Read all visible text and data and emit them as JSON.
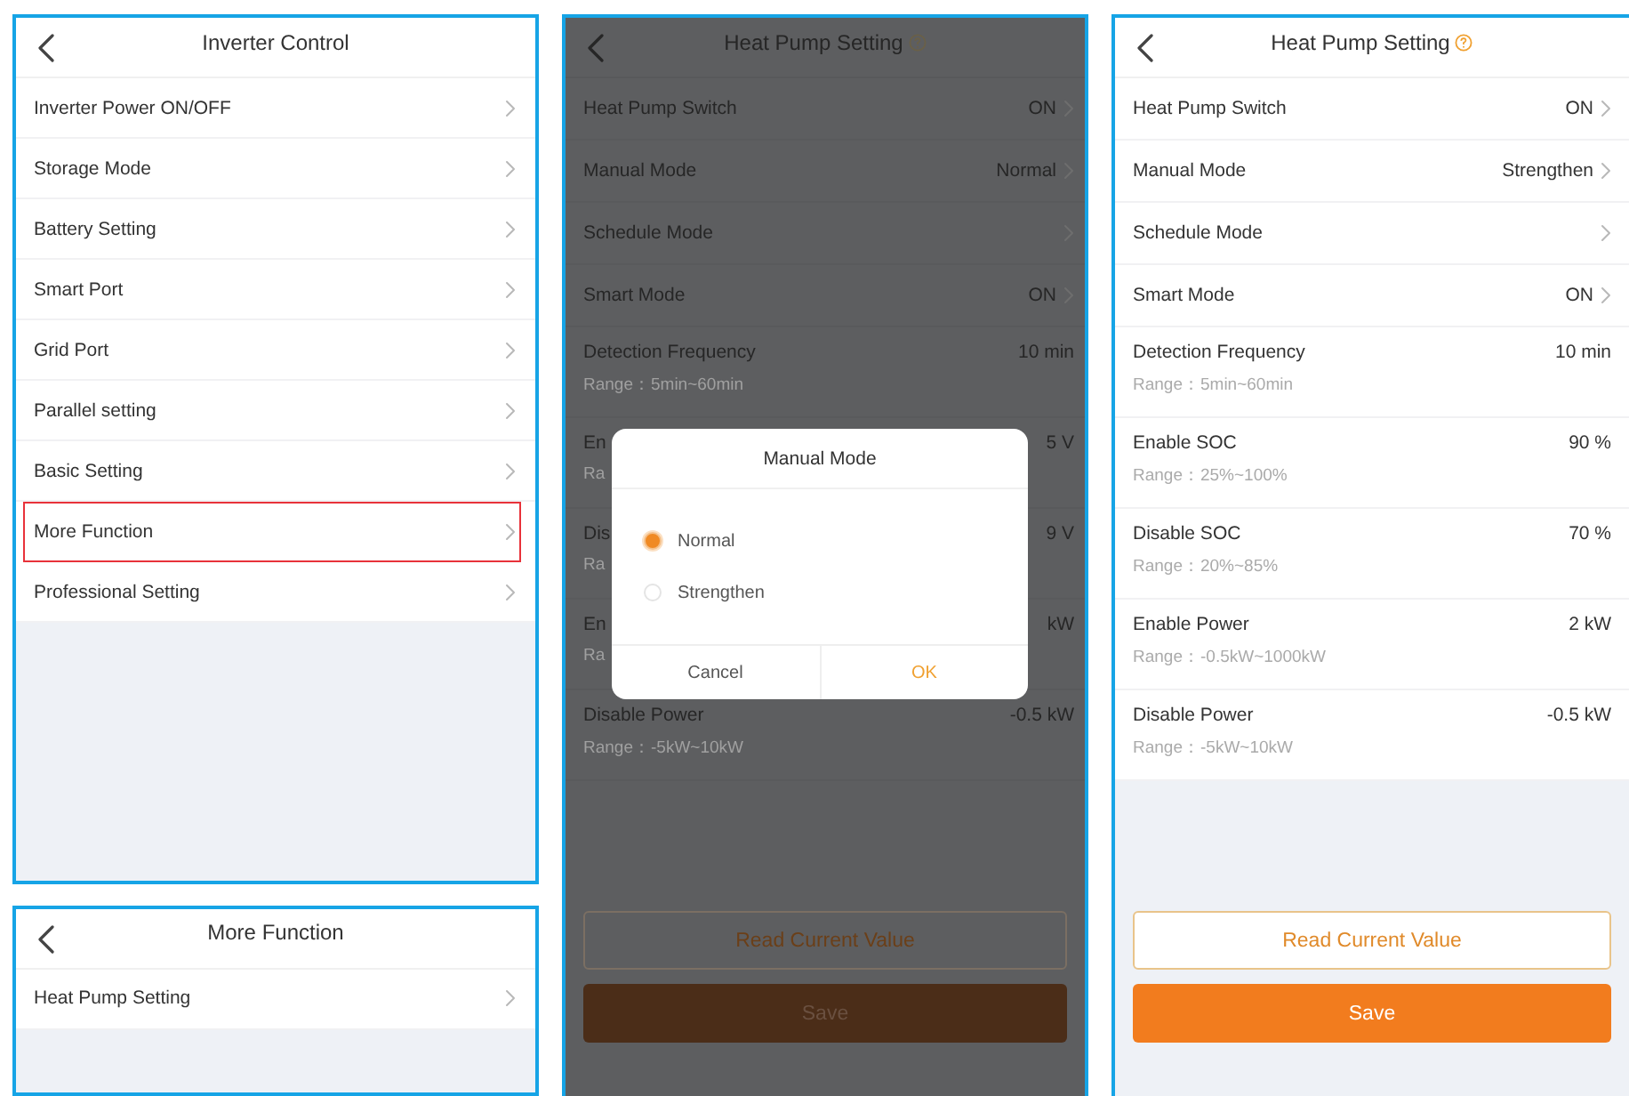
{
  "screens": [
    {
      "kind": "menu",
      "title": "Inverter Control",
      "items": [
        {
          "label": "Inverter Power ON/OFF",
          "highlighted": false
        },
        {
          "label": "Storage Mode",
          "highlighted": false
        },
        {
          "label": "Battery Setting",
          "highlighted": false
        },
        {
          "label": "Smart Port",
          "highlighted": false
        },
        {
          "label": "Grid Port",
          "highlighted": false
        },
        {
          "label": "Parallel setting",
          "highlighted": false
        },
        {
          "label": "Basic Setting",
          "highlighted": false
        },
        {
          "label": "More Function",
          "highlighted": true
        },
        {
          "label": "Professional Setting",
          "highlighted": false
        }
      ]
    },
    {
      "kind": "menu",
      "title": "More Function",
      "items": [
        {
          "label": "Heat Pump Setting",
          "highlighted": false
        }
      ]
    },
    {
      "kind": "settings",
      "title": "Heat Pump Setting",
      "dimmed": true,
      "rows": [
        {
          "label": "Heat Pump Switch",
          "value": "ON",
          "chevron": true
        },
        {
          "label": "Manual Mode",
          "value": "Normal",
          "chevron": true
        },
        {
          "label": "Schedule Mode",
          "chevron": true
        },
        {
          "label": "Smart Mode",
          "value": "ON",
          "chevron": true
        },
        {
          "label": "Detection Frequency",
          "value": "10 min",
          "range": "Range：5min~60min",
          "chevron": false
        },
        {
          "label": "En",
          "value": "5 V",
          "range": "Ra",
          "chevron": false
        },
        {
          "label": "Dis",
          "value": "9 V",
          "range": "Ra",
          "chevron": false
        },
        {
          "label": "En",
          "value": "kW",
          "range": "Ra",
          "chevron": false
        },
        {
          "label": "Disable Power",
          "value": "-0.5 kW",
          "range": "Range：-5kW~10kW",
          "chevron": false
        }
      ],
      "buttons": [
        {
          "label": "Read Current Value",
          "kind": "outline"
        },
        {
          "label": "Save",
          "kind": "primary"
        }
      ],
      "dialog": {
        "title": "Manual Mode",
        "options": [
          {
            "label": "Normal",
            "selected": true
          },
          {
            "label": "Strengthen",
            "selected": false
          }
        ],
        "buttons": [
          {
            "label": "Cancel",
            "kind": "cancel"
          },
          {
            "label": "OK",
            "kind": "confirm"
          }
        ]
      }
    },
    {
      "kind": "settings",
      "title": "Heat Pump Setting",
      "dimmed": false,
      "rows": [
        {
          "label": "Heat Pump Switch",
          "value": "ON",
          "chevron": true
        },
        {
          "label": "Manual Mode",
          "value": "Strengthen",
          "chevron": true
        },
        {
          "label": "Schedule Mode",
          "chevron": true
        },
        {
          "label": "Smart Mode",
          "value": "ON",
          "chevron": true
        },
        {
          "label": "Detection Frequency",
          "value": "10 min",
          "range": "Range：5min~60min",
          "chevron": false
        },
        {
          "label": "Enable SOC",
          "value": "90 %",
          "range": "Range：25%~100%",
          "chevron": false
        },
        {
          "label": "Disable SOC",
          "value": "70 %",
          "range": "Range：20%~85%",
          "chevron": false
        },
        {
          "label": "Enable Power",
          "value": "2 kW",
          "range": "Range：-0.5kW~1000kW",
          "chevron": false
        },
        {
          "label": "Disable Power",
          "value": "-0.5 kW",
          "range": "Range：-5kW~10kW",
          "chevron": false
        }
      ],
      "buttons": [
        {
          "label": "Read Current Value",
          "kind": "outline"
        },
        {
          "label": "Save",
          "kind": "primary"
        }
      ]
    }
  ]
}
